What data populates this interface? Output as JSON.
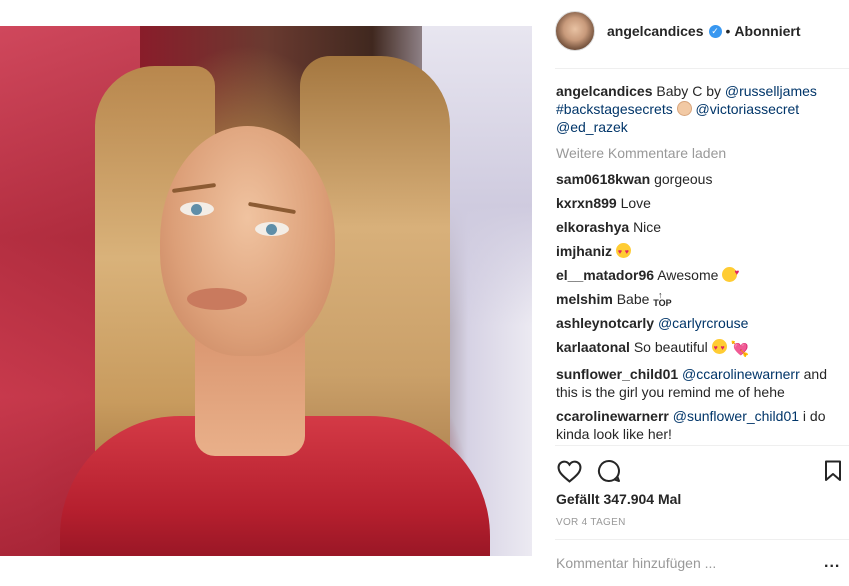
{
  "post": {
    "image_alt": "photo-post",
    "header": {
      "username": "angelcandices",
      "separator": "•",
      "follow_state": "Abonniert"
    },
    "caption": {
      "username": "angelcandices",
      "text": "Baby C by",
      "mention1": "@russelljames",
      "hashtag": "#backstagesecrets",
      "mention2": "@victoriassecret",
      "mention3": "@ed_razek"
    },
    "load_more": "Weitere Kommentare laden",
    "comments": [
      {
        "user": "sam0618kwan",
        "text": "gorgeous"
      },
      {
        "user": "kxrxn899",
        "text": "Love"
      },
      {
        "user": "elkorashya",
        "text": "Nice"
      },
      {
        "user": "imjhaniz",
        "text": ""
      },
      {
        "user": "el__matador96",
        "text": "Awesome"
      },
      {
        "user": "melshim",
        "text": "Babe"
      },
      {
        "user": "ashleynotcarly",
        "mention": "@carlyrcrouse"
      },
      {
        "user": "karlaatonal",
        "text": "So beautiful"
      },
      {
        "user": "sunflower_child01",
        "mention": "@ccarolinewarnerr",
        "text": "and this is the girl you remind me of hehe"
      },
      {
        "user": "ccarolinewarnerr",
        "mention": "@sunflower_child01",
        "text": "i do kinda look like her!"
      }
    ],
    "likes": "Gefällt 347.904 Mal",
    "time_ago": "VOR 4 TAGEN",
    "comment_placeholder": "Kommentar hinzufügen ...",
    "more_label": "..."
  },
  "colors": {
    "mention": "#003569",
    "muted": "#999999",
    "verified": "#3897f0",
    "text": "#262626"
  },
  "icons": {
    "verified": "verified-badge-icon",
    "like": "heart-outline-icon",
    "comment": "speech-bubble-icon",
    "save": "bookmark-icon",
    "more": "more-dots-icon"
  }
}
